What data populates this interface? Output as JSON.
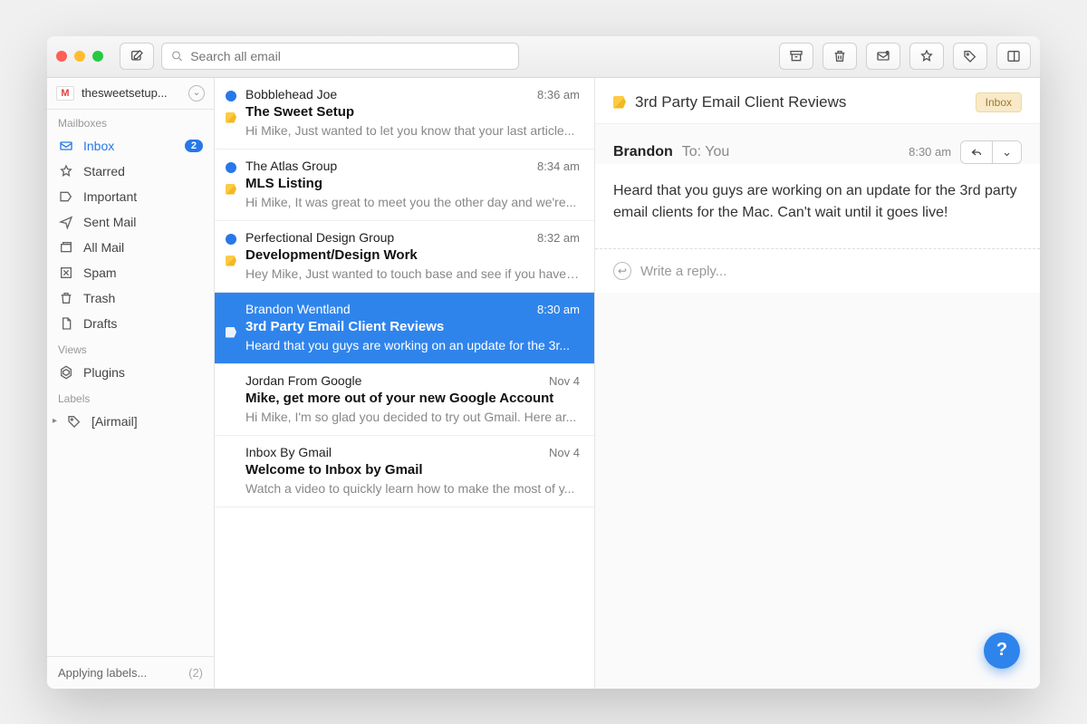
{
  "search": {
    "placeholder": "Search all email"
  },
  "account": {
    "name": "thesweetsetup..."
  },
  "sections": {
    "mailboxes": "Mailboxes",
    "views": "Views",
    "labels": "Labels"
  },
  "nav": {
    "inbox": {
      "label": "Inbox",
      "badge": "2"
    },
    "starred": {
      "label": "Starred"
    },
    "important": {
      "label": "Important"
    },
    "sent": {
      "label": "Sent Mail"
    },
    "all": {
      "label": "All Mail"
    },
    "spam": {
      "label": "Spam"
    },
    "trash": {
      "label": "Trash"
    },
    "drafts": {
      "label": "Drafts"
    },
    "plugins": {
      "label": "Plugins"
    },
    "airmail": {
      "label": "[Airmail]"
    }
  },
  "status": {
    "text": "Applying labels...",
    "count": "(2)"
  },
  "messages": [
    {
      "sender": "Bobblehead Joe",
      "time": "8:36 am",
      "subject": "The Sweet Setup",
      "preview": "Hi Mike, Just wanted to let you know that your last article...",
      "unread": true,
      "tagged": true
    },
    {
      "sender": "The Atlas Group",
      "time": "8:34 am",
      "subject": "MLS Listing",
      "preview": "Hi Mike, It was great to meet you the other day and we're...",
      "unread": true,
      "tagged": true
    },
    {
      "sender": "Perfectional Design Group",
      "time": "8:32 am",
      "subject": "Development/Design Work",
      "preview": "Hey Mike, Just wanted to touch base and see if you have ...",
      "unread": true,
      "tagged": true
    },
    {
      "sender": "Brandon Wentland",
      "time": "8:30 am",
      "subject": "3rd Party Email Client Reviews",
      "preview": "Heard that you guys are working on an update for the 3r...",
      "unread": false,
      "tagged": true,
      "selected": true
    },
    {
      "sender": "Jordan From Google",
      "time": "Nov 4",
      "subject": "Mike, get more out of your new Google Account",
      "preview": "Hi Mike, I'm so glad you decided to try out Gmail. Here ar...",
      "unread": false,
      "tagged": false
    },
    {
      "sender": "Inbox By Gmail",
      "time": "Nov 4",
      "subject": "Welcome to Inbox by Gmail",
      "preview": "Watch a video to quickly learn how to make the most of y...",
      "unread": false,
      "tagged": false
    }
  ],
  "reader": {
    "subject": "3rd Party Email Client Reviews",
    "label": "Inbox",
    "from": "Brandon",
    "to": "To: You",
    "time": "8:30 am",
    "body": "Heard that you guys  are working on an update for the 3rd party email clients for the Mac.  Can't wait until it goes live!",
    "reply_placeholder": "Write a reply..."
  },
  "help": "?"
}
